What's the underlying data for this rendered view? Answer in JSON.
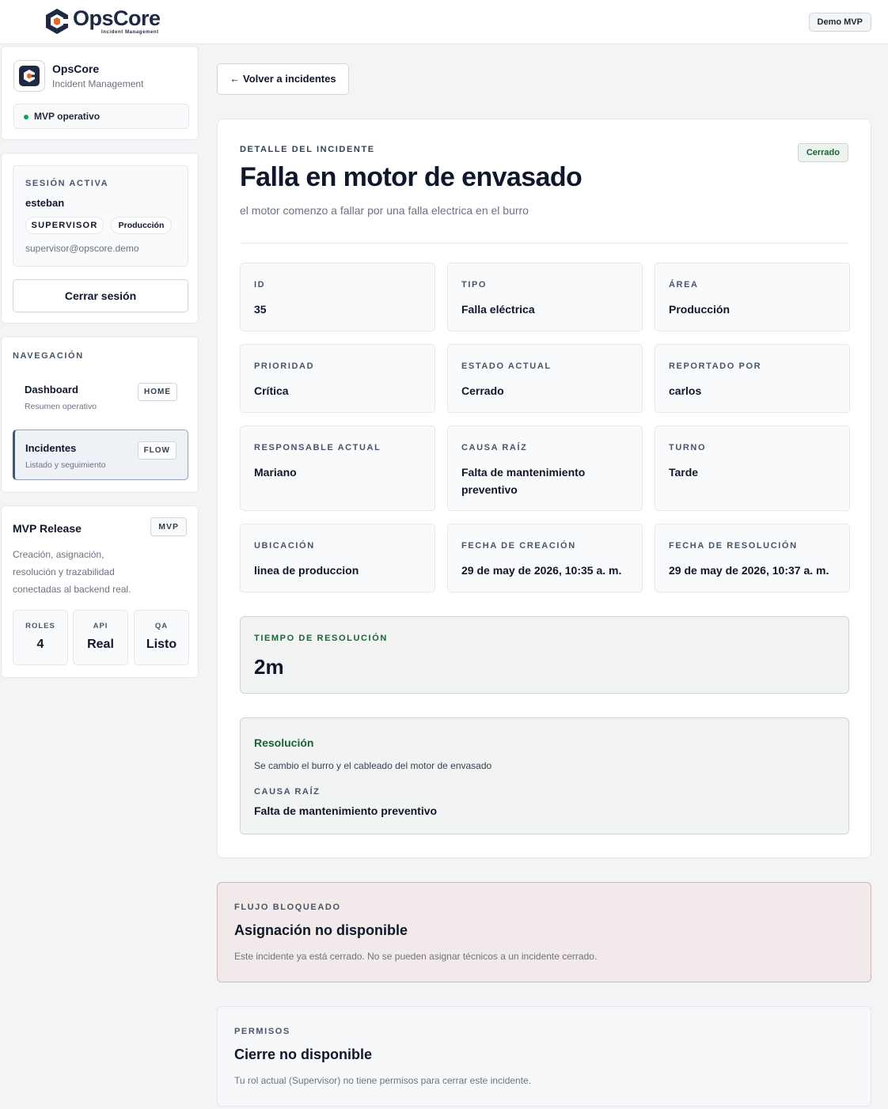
{
  "app": {
    "logo_name": "OpsCore",
    "logo_sub": "Incident Management",
    "demo_badge": "Demo MVP"
  },
  "sidebar": {
    "brand": {
      "title": "OpsCore",
      "subtitle": "Incident Management",
      "status": "MVP operativo",
      "status_color": "#16a34a"
    },
    "session": {
      "heading": "SESIÓN ACTIVA",
      "user": "esteban",
      "role": "SUPERVISOR",
      "area": "Producción",
      "email": "supervisor@opscore.demo",
      "logout_label": "Cerrar sesión"
    },
    "nav": {
      "heading": "NAVEGACIÓN",
      "items": [
        {
          "label": "Dashboard",
          "sub": "Resumen operativo",
          "tag": "HOME"
        },
        {
          "label": "Incidentes",
          "sub": "Listado y seguimiento",
          "tag": "FLOW"
        }
      ]
    },
    "release": {
      "title": "MVP Release",
      "tag": "MVP",
      "description": "Creación, asignación, resolución y trazabilidad conectadas al backend real.",
      "stats": [
        {
          "key": "ROLES",
          "value": "4"
        },
        {
          "key": "API",
          "value": "Real"
        },
        {
          "key": "QA",
          "value": "Listo"
        }
      ]
    }
  },
  "main": {
    "back_label": "← Volver a incidentes",
    "detail": {
      "eyebrow": "DETALLE DEL INCIDENTE",
      "status": "Cerrado",
      "status_color": "#166534",
      "title": "Falla en motor de envasado",
      "description": "el motor comenzo a fallar por una falla electrica en el burro",
      "fields": [
        {
          "label": "ID",
          "value": "35"
        },
        {
          "label": "TIPO",
          "value": "Falla eléctrica"
        },
        {
          "label": "ÁREA",
          "value": "Producción"
        },
        {
          "label": "PRIORIDAD",
          "value": "Crítica"
        },
        {
          "label": "ESTADO ACTUAL",
          "value": "Cerrado"
        },
        {
          "label": "REPORTADO POR",
          "value": "carlos"
        },
        {
          "label": "RESPONSABLE ACTUAL",
          "value": "Mariano"
        },
        {
          "label": "CAUSA RAÍZ",
          "value": "Falta de mantenimiento preventivo"
        },
        {
          "label": "TURNO",
          "value": "Tarde"
        },
        {
          "label": "UBICACIÓN",
          "value": "linea de produccion"
        },
        {
          "label": "FECHA DE CREACIÓN",
          "value": "29 de may de 2026, 10:35 a. m."
        },
        {
          "label": "FECHA DE RESOLUCIÓN",
          "value": "29 de may de 2026, 10:37 a. m."
        }
      ],
      "resolution_time": {
        "label": "TIEMPO DE RESOLUCIÓN",
        "value": "2m"
      },
      "resolution": {
        "title": "Resolución",
        "text": "Se cambio el burro y el cableado del motor de envasado",
        "cause_label": "CAUSA RAÍZ",
        "cause_value": "Falta de mantenimiento preventivo"
      }
    },
    "blocked": {
      "eyebrow": "FLUJO BLOQUEADO",
      "title": "Asignación no disponible",
      "text": "Este incidente ya está cerrado. No se pueden asignar técnicos a un incidente cerrado."
    },
    "permissions": {
      "eyebrow": "PERMISOS",
      "title": "Cierre no disponible",
      "text": "Tu rol actual (Supervisor) no tiene permisos para cerrar este incidente."
    }
  }
}
